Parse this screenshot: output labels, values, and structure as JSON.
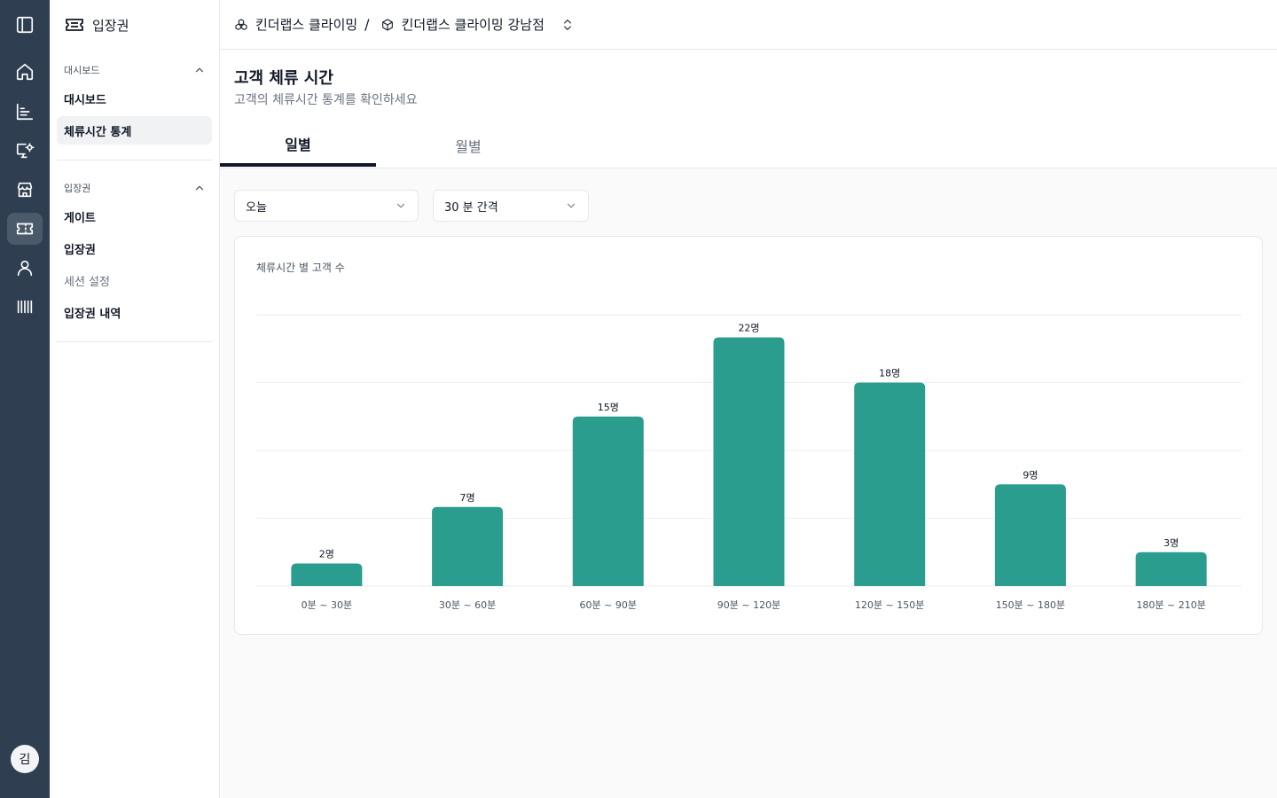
{
  "rail": {
    "icons": [
      "panel-toggle-icon",
      "home-icon",
      "chart-icon",
      "monitor-settings-icon",
      "store-icon",
      "ticket-icon",
      "user-icon",
      "barcode-icon"
    ],
    "active": "ticket-icon",
    "avatar_initial": "김"
  },
  "sidebar": {
    "app_title": "입장권",
    "groups": [
      {
        "label": "대시보드",
        "items": [
          {
            "label": "대시보드"
          },
          {
            "label": "체류시간 통계",
            "active": true
          }
        ]
      },
      {
        "label": "입장권",
        "items": [
          {
            "label": "게이트"
          },
          {
            "label": "입장권"
          },
          {
            "label": "세션 설정",
            "muted": true
          },
          {
            "label": "입장권 내역"
          }
        ]
      }
    ]
  },
  "topbar": {
    "org_name": "킨더랩스 클라이밍",
    "separator": "/",
    "branch_name": "킨더랩스 클라이밍 강남점"
  },
  "header": {
    "title": "고객 체류 시간",
    "subtitle": "고객의 체류시간 통계를 확인하세요",
    "tabs": [
      {
        "label": "일별",
        "active": true
      },
      {
        "label": "월별",
        "active": false
      }
    ]
  },
  "filters": {
    "period": "오늘",
    "interval": "30 분 간격"
  },
  "colors": {
    "bar": "#2a9d8f",
    "rail_bg": "#2f3e50",
    "grid": "#eeeeee"
  },
  "chart_data": {
    "type": "bar",
    "title": "체류시간 별 고객 수",
    "categories": [
      "0분 ~ 30분",
      "30분 ~ 60분",
      "60분 ~ 90분",
      "90분 ~ 120분",
      "120분 ~ 150분",
      "150분 ~ 180분",
      "180분 ~ 210분"
    ],
    "values": [
      2,
      7,
      15,
      22,
      18,
      9,
      3
    ],
    "value_suffix": "명",
    "ylim": [
      0,
      24
    ],
    "grid": true
  }
}
